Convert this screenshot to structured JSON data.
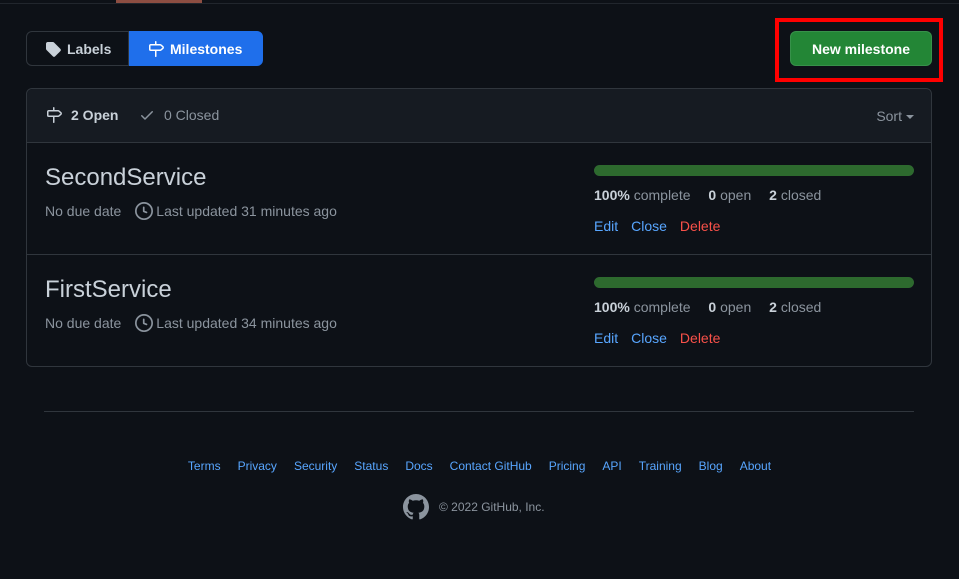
{
  "subnav": {
    "labels_label": "Labels",
    "milestones_label": "Milestones"
  },
  "new_milestone_label": "New milestone",
  "filters": {
    "open_label": "2 Open",
    "closed_label": "0 Closed",
    "sort_label": "Sort"
  },
  "milestones": [
    {
      "title": "SecondService",
      "due": "No due date",
      "updated": "Last updated 31 minutes ago",
      "progress_percent": 100,
      "percent_value": "100%",
      "percent_text": "complete",
      "open_count": "0",
      "open_text": "open",
      "closed_count": "2",
      "closed_text": "closed",
      "edit_label": "Edit",
      "close_label": "Close",
      "delete_label": "Delete"
    },
    {
      "title": "FirstService",
      "due": "No due date",
      "updated": "Last updated 34 minutes ago",
      "progress_percent": 100,
      "percent_value": "100%",
      "percent_text": "complete",
      "open_count": "0",
      "open_text": "open",
      "closed_count": "2",
      "closed_text": "closed",
      "edit_label": "Edit",
      "close_label": "Close",
      "delete_label": "Delete"
    }
  ],
  "footer": {
    "links": [
      "Terms",
      "Privacy",
      "Security",
      "Status",
      "Docs",
      "Contact GitHub",
      "Pricing",
      "API",
      "Training",
      "Blog",
      "About"
    ],
    "copyright": "© 2022 GitHub, Inc."
  },
  "icons": {
    "labels": "tag-icon",
    "milestones": "milestone-icon",
    "closed": "check-icon",
    "updated": "clock-icon",
    "logo": "github-mark-icon"
  },
  "colors": {
    "background": "#0d1117",
    "accent_blue": "#1f6feb",
    "primary_green": "#238636",
    "progress_green": "#2d6a2e",
    "link": "#58a6ff",
    "danger": "#f85149",
    "highlight": "#ff0000"
  }
}
